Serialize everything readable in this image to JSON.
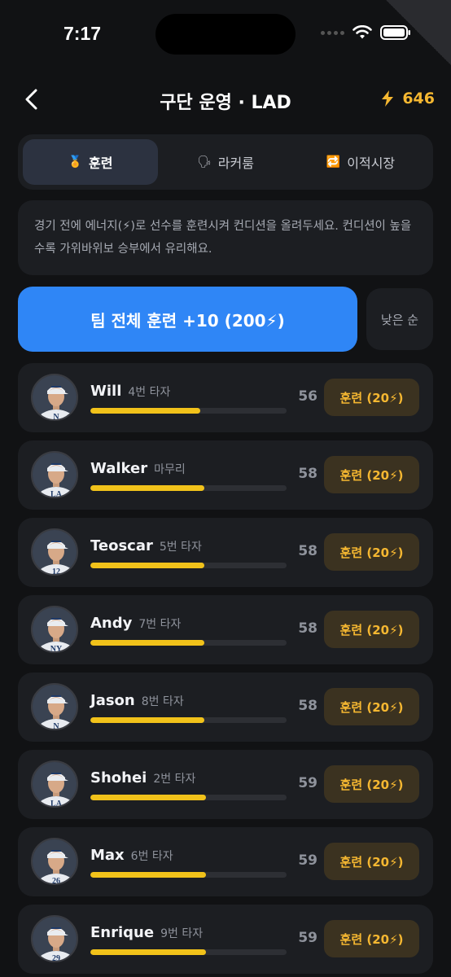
{
  "status": {
    "time": "7:17"
  },
  "header": {
    "title": "구단 운영 · LAD",
    "energy": "646"
  },
  "tabs": [
    {
      "label": "훈련",
      "icon": "trophy-icon",
      "glyph": "🏅",
      "active": true
    },
    {
      "label": "라커룸",
      "icon": "speech-icon",
      "glyph": "🗣",
      "active": false
    },
    {
      "label": "이적시장",
      "icon": "exchange-icon",
      "glyph": "🔁",
      "active": false
    }
  ],
  "info": {
    "text": "경기 전에 에너지(⚡)로 선수를 훈련시켜 컨디션을 올려두세요. 컨디션이 높을수록 가위바위보 승부에서 유리해요."
  },
  "actions": {
    "train_all_label": "팀 전체 훈련 +10 (200⚡)",
    "sort_label": "낮은 순"
  },
  "players": [
    {
      "name": "Will",
      "role": "4번 타자",
      "condition": 56,
      "train_label": "훈련 (20⚡)",
      "jersey": "N"
    },
    {
      "name": "Walker",
      "role": "마무리",
      "condition": 58,
      "train_label": "훈련 (20⚡)",
      "jersey": "LA"
    },
    {
      "name": "Teoscar",
      "role": "5번 타자",
      "condition": 58,
      "train_label": "훈련 (20⚡)",
      "jersey": "12"
    },
    {
      "name": "Andy",
      "role": "7번 타자",
      "condition": 58,
      "train_label": "훈련 (20⚡)",
      "jersey": "NY"
    },
    {
      "name": "Jason",
      "role": "8번 타자",
      "condition": 58,
      "train_label": "훈련 (20⚡)",
      "jersey": "N"
    },
    {
      "name": "Shohei",
      "role": "2번 타자",
      "condition": 59,
      "train_label": "훈련 (20⚡)",
      "jersey": "LA"
    },
    {
      "name": "Max",
      "role": "6번 타자",
      "condition": 59,
      "train_label": "훈련 (20⚡)",
      "jersey": "26"
    },
    {
      "name": "Enrique",
      "role": "9번 타자",
      "condition": 59,
      "train_label": "훈련 (20⚡)",
      "jersey": "29"
    }
  ],
  "colors": {
    "accent": "#2f86f6",
    "energy": "#f5b731",
    "bar": "#f1c21a",
    "background": "#111214",
    "card": "#1c1e22"
  }
}
